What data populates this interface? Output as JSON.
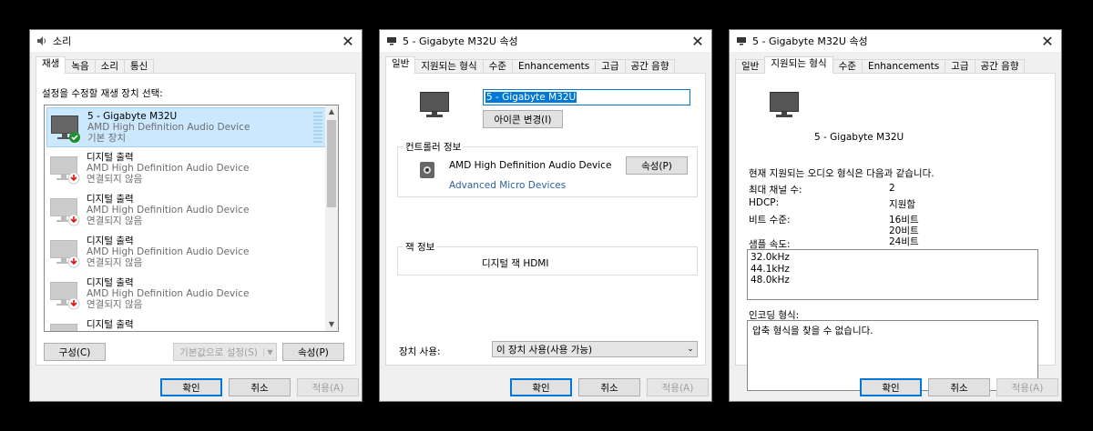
{
  "dlg1": {
    "title": "소리",
    "tabs": [
      "재생",
      "녹음",
      "소리",
      "통신"
    ],
    "instruction": "설정을 수정할 재생 장치 선택:",
    "devices": [
      {
        "name": "5 - Gigabyte M32U",
        "driver": "AMD High Definition Audio Device",
        "status": "기본 장치"
      },
      {
        "name": "디지털 출력",
        "driver": "AMD High Definition Audio Device",
        "status": "연결되지 않음"
      },
      {
        "name": "디지털 출력",
        "driver": "AMD High Definition Audio Device",
        "status": "연결되지 않음"
      },
      {
        "name": "디지털 출력",
        "driver": "AMD High Definition Audio Device",
        "status": "연결되지 않음"
      },
      {
        "name": "디지털 출력",
        "driver": "AMD High Definition Audio Device",
        "status": "연결되지 않음"
      },
      {
        "name": "디지털 출력",
        "driver": "",
        "status": ""
      }
    ],
    "configure": "구성(C)",
    "set_default": "기본값으로 설정(S)",
    "properties": "속성(P)",
    "ok": "확인",
    "cancel": "취소",
    "apply": "적용(A)"
  },
  "dlg2": {
    "title": "5 - Gigabyte M32U 속성",
    "tabs": [
      "일반",
      "지원되는 형식",
      "수준",
      "Enhancements",
      "고급",
      "공간 음향"
    ],
    "device_name": "5 - Gigabyte M32U",
    "change_icon": "아이콘 변경(I)",
    "controller_label": "컨트롤러 정보",
    "controller_name": "AMD High Definition Audio Device",
    "controller_props": "속성(P)",
    "controller_vendor": "Advanced Micro Devices",
    "jack_label": "잭 정보",
    "jack_value": "디지털 잭 HDMI",
    "usage_label": "장치 사용:",
    "usage_value": "이 장치 사용(사용 가능)",
    "ok": "확인",
    "cancel": "취소",
    "apply": "적용(A)"
  },
  "dlg3": {
    "title": "5 - Gigabyte M32U 속성",
    "tabs": [
      "일반",
      "지원되는 형식",
      "수준",
      "Enhancements",
      "고급",
      "공간 음향"
    ],
    "device_name": "5 - Gigabyte M32U",
    "current_formats": "현재 지원되는 오디오 형식은 다음과 같습니다.",
    "max_channels_label": "최대 채널 수:",
    "max_channels_value": "2",
    "hdcp_label": "HDCP:",
    "hdcp_value": "지원함",
    "bit_depth_label": "비트 수준:",
    "bit_depths": [
      "16비트",
      "20비트",
      "24비트"
    ],
    "sample_rate_label": "샘플 속도:",
    "sample_rates": [
      "32.0kHz",
      "44.1kHz",
      "48.0kHz"
    ],
    "encoding_label": "인코딩 형식:",
    "encoding_value": "압축 형식을 찾을 수 없습니다.",
    "ok": "확인",
    "cancel": "취소",
    "apply": "적용(A)"
  }
}
